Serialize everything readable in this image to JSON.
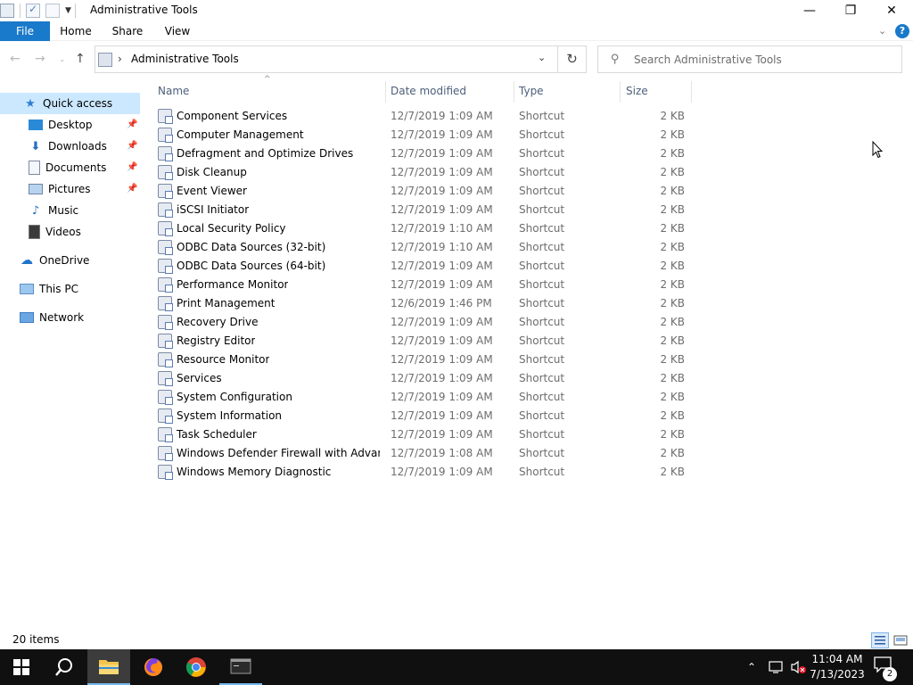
{
  "window": {
    "title": "Administrative Tools",
    "minimize_icon": "—",
    "maximize_icon": "❐",
    "close_icon": "✕"
  },
  "ribbon": {
    "tabs": [
      "File",
      "Home",
      "Share",
      "View"
    ],
    "help_label": "?"
  },
  "address": {
    "path": "Administrative Tools",
    "separator": "›"
  },
  "search": {
    "placeholder": "Search Administrative Tools"
  },
  "nav_pane": {
    "items": [
      {
        "label": "Quick access",
        "icon": "star-icon"
      },
      {
        "label": "Desktop",
        "icon": "desktop-icon",
        "pinned": true
      },
      {
        "label": "Downloads",
        "icon": "download-arrow-icon",
        "pinned": true
      },
      {
        "label": "Documents",
        "icon": "documents-icon",
        "pinned": true
      },
      {
        "label": "Pictures",
        "icon": "pictures-icon",
        "pinned": true
      },
      {
        "label": "Music",
        "icon": "music-note-icon"
      },
      {
        "label": "Videos",
        "icon": "film-icon"
      },
      {
        "label": "OneDrive",
        "icon": "cloud-icon"
      },
      {
        "label": "This PC",
        "icon": "computer-icon"
      },
      {
        "label": "Network",
        "icon": "network-icon"
      }
    ]
  },
  "columns": {
    "name": "Name",
    "date": "Date modified",
    "type": "Type",
    "size": "Size"
  },
  "files": [
    {
      "name": "Component Services",
      "date": "12/7/2019 1:09 AM",
      "type": "Shortcut",
      "size": "2 KB"
    },
    {
      "name": "Computer Management",
      "date": "12/7/2019 1:09 AM",
      "type": "Shortcut",
      "size": "2 KB"
    },
    {
      "name": "Defragment and Optimize Drives",
      "date": "12/7/2019 1:09 AM",
      "type": "Shortcut",
      "size": "2 KB"
    },
    {
      "name": "Disk Cleanup",
      "date": "12/7/2019 1:09 AM",
      "type": "Shortcut",
      "size": "2 KB"
    },
    {
      "name": "Event Viewer",
      "date": "12/7/2019 1:09 AM",
      "type": "Shortcut",
      "size": "2 KB"
    },
    {
      "name": "iSCSI Initiator",
      "date": "12/7/2019 1:09 AM",
      "type": "Shortcut",
      "size": "2 KB"
    },
    {
      "name": "Local Security Policy",
      "date": "12/7/2019 1:10 AM",
      "type": "Shortcut",
      "size": "2 KB"
    },
    {
      "name": "ODBC Data Sources (32-bit)",
      "date": "12/7/2019 1:10 AM",
      "type": "Shortcut",
      "size": "2 KB"
    },
    {
      "name": "ODBC Data Sources (64-bit)",
      "date": "12/7/2019 1:09 AM",
      "type": "Shortcut",
      "size": "2 KB"
    },
    {
      "name": "Performance Monitor",
      "date": "12/7/2019 1:09 AM",
      "type": "Shortcut",
      "size": "2 KB"
    },
    {
      "name": "Print Management",
      "date": "12/6/2019 1:46 PM",
      "type": "Shortcut",
      "size": "2 KB"
    },
    {
      "name": "Recovery Drive",
      "date": "12/7/2019 1:09 AM",
      "type": "Shortcut",
      "size": "2 KB"
    },
    {
      "name": "Registry Editor",
      "date": "12/7/2019 1:09 AM",
      "type": "Shortcut",
      "size": "2 KB"
    },
    {
      "name": "Resource Monitor",
      "date": "12/7/2019 1:09 AM",
      "type": "Shortcut",
      "size": "2 KB"
    },
    {
      "name": "Services",
      "date": "12/7/2019 1:09 AM",
      "type": "Shortcut",
      "size": "2 KB"
    },
    {
      "name": "System Configuration",
      "date": "12/7/2019 1:09 AM",
      "type": "Shortcut",
      "size": "2 KB"
    },
    {
      "name": "System Information",
      "date": "12/7/2019 1:09 AM",
      "type": "Shortcut",
      "size": "2 KB"
    },
    {
      "name": "Task Scheduler",
      "date": "12/7/2019 1:09 AM",
      "type": "Shortcut",
      "size": "2 KB"
    },
    {
      "name": "Windows Defender Firewall with Advanc...",
      "date": "12/7/2019 1:08 AM",
      "type": "Shortcut",
      "size": "2 KB"
    },
    {
      "name": "Windows Memory Diagnostic",
      "date": "12/7/2019 1:09 AM",
      "type": "Shortcut",
      "size": "2 KB"
    }
  ],
  "status": {
    "item_count": "20 items"
  },
  "taskbar": {
    "time": "11:04 AM",
    "date": "7/13/2023",
    "notification_count": "2"
  },
  "colors": {
    "accent": "#1979ca",
    "selection": "#cce8ff",
    "taskbar": "#101010"
  }
}
